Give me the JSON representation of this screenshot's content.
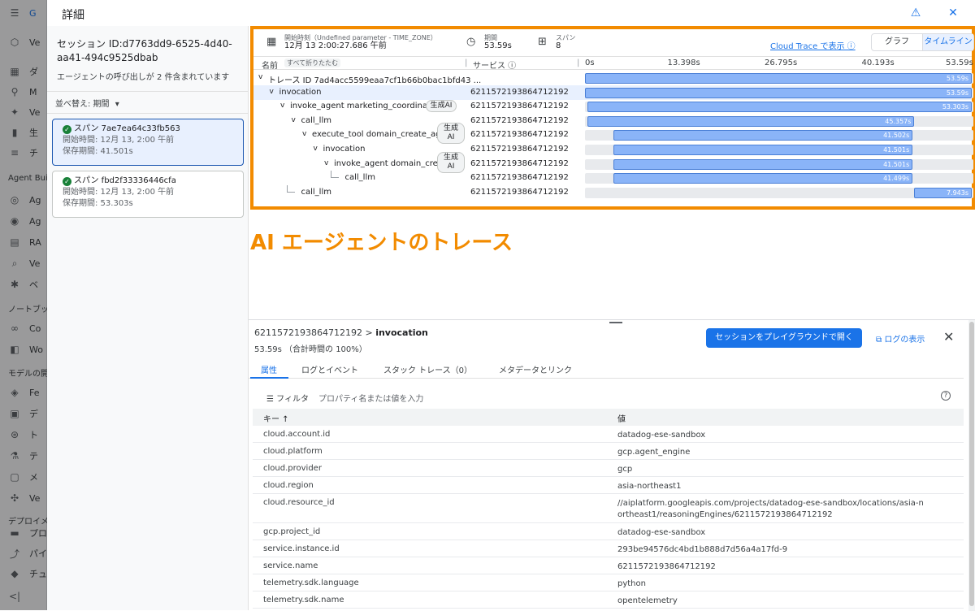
{
  "nav": {
    "items": [
      {
        "icon": "dashboard-icon",
        "glyph": "▦",
        "label": "ダ"
      },
      {
        "icon": "model-icon",
        "glyph": "⚲",
        "label": "M"
      },
      {
        "icon": "sparkle-icon",
        "glyph": "✦",
        "label": "Ve"
      },
      {
        "icon": "chart-icon",
        "glyph": "▮",
        "label": "生"
      },
      {
        "icon": "text-icon",
        "glyph": "≡",
        "label": "チ"
      }
    ],
    "section1": "Agent Bui",
    "items2": [
      {
        "icon": "agent-icon",
        "glyph": "◎",
        "label": "Ag"
      },
      {
        "icon": "engine-icon",
        "glyph": "◉",
        "label": "Ag"
      },
      {
        "icon": "rag-icon",
        "glyph": "▤",
        "label": "RA"
      },
      {
        "icon": "search-icon",
        "glyph": "⌕",
        "label": "Ve"
      },
      {
        "icon": "vector-icon",
        "glyph": "✱",
        "label": "ベ"
      }
    ],
    "section2": "ノートブッ",
    "items3": [
      {
        "icon": "colab-icon",
        "glyph": "∞",
        "label": "Co"
      },
      {
        "icon": "workbench-icon",
        "glyph": "◧",
        "label": "Wo"
      }
    ],
    "section3": "モデルの開",
    "items4": [
      {
        "icon": "feature-icon",
        "glyph": "◈",
        "label": "Fe"
      },
      {
        "icon": "dataset-icon",
        "glyph": "▣",
        "label": "デ"
      },
      {
        "icon": "training-icon",
        "glyph": "⊛",
        "label": "ト"
      },
      {
        "icon": "experiment-icon",
        "glyph": "⚗",
        "label": "テ"
      },
      {
        "icon": "metadata-icon",
        "glyph": "▢",
        "label": "メ"
      },
      {
        "icon": "vizier-icon",
        "glyph": "✣",
        "label": "Ve"
      }
    ],
    "section4": "デプロイメ",
    "items5": [
      {
        "icon": "prompt-icon",
        "glyph": "▬",
        "label": "プロ"
      },
      {
        "icon": "pipeline-icon",
        "glyph": "⤴",
        "label": "パイ"
      },
      {
        "icon": "tuning-icon",
        "glyph": "◆",
        "label": "チュ"
      }
    ],
    "collapse": "<|",
    "brand_fragment": "G",
    "brand_fragment2": "Ve"
  },
  "dialog": {
    "title": "詳細",
    "feedback_glyph": "⚠",
    "close_glyph": "✕"
  },
  "left": {
    "session_id": "セッション ID:d7763dd9-6525-4d40-aa41-494c9525dbab",
    "subtitle": "エージェントの呼び出しが 2 件含まれています",
    "sort_label": "並べ替え: 期間",
    "cards": [
      {
        "title": "スパン 7ae7ea64c33fb563",
        "start": "開始時間: 12月 13, 2:00 午前",
        "duration": "保存期間: 41.501s"
      },
      {
        "title": "スパン fbd2f33336446cfa",
        "start": "開始時間: 12月 13, 2:00 午前",
        "duration": "保存期間: 53.303s"
      }
    ]
  },
  "trace": {
    "start_label": "開始時刻（Undefined parameter - TIME_ZONE）",
    "start_value": "12月 13 2:00:27.686 午前",
    "duration_label": "期間",
    "duration_value": "53.59s",
    "span_label": "スパン",
    "span_value": "8",
    "cloud_trace_link": "Cloud Trace で表示 ⓘ",
    "view_graph": "グラフ",
    "view_timeline": "タイムライン",
    "col_name": "名前",
    "collapse_all": "すべて折りたたむ",
    "col_service": "サービス ⓘ",
    "axis_ticks": [
      "0s",
      "13.398s",
      "26.795s",
      "40.193s",
      "53.59s"
    ],
    "total_seconds": 53.59,
    "rows": [
      {
        "indent": 0,
        "toggle": "v",
        "name": "トレース ID 7ad4acc5599eaa7cf1b66b0bac1bfd43 ...",
        "service": "",
        "start": 0,
        "dur": 53.59,
        "label": "53.59s",
        "selected": false,
        "chip": ""
      },
      {
        "indent": 1,
        "toggle": "v",
        "name": "invocation",
        "service": "6211572193864712192",
        "start": 0,
        "dur": 53.59,
        "label": "53.59s",
        "selected": true,
        "chip": ""
      },
      {
        "indent": 2,
        "toggle": "v",
        "name": "invoke_agent marketing_coordinator",
        "service": "6211572193864712192",
        "start": 0.29,
        "dur": 53.303,
        "label": "53.303s",
        "selected": false,
        "chip": "生成AI"
      },
      {
        "indent": 3,
        "toggle": "v",
        "name": "call_llm",
        "service": "6211572193864712192",
        "start": 0.29,
        "dur": 45.357,
        "label": "45.357s",
        "selected": false,
        "chip": ""
      },
      {
        "indent": 4,
        "toggle": "v",
        "name": "execute_tool domain_create_ag...",
        "service": "6211572193864712192",
        "start": 3.9,
        "dur": 41.502,
        "label": "41.502s",
        "selected": false,
        "chip": "生成\nAI"
      },
      {
        "indent": 5,
        "toggle": "v",
        "name": "invocation",
        "service": "6211572193864712192",
        "start": 3.9,
        "dur": 41.501,
        "label": "41.501s",
        "selected": false,
        "chip": ""
      },
      {
        "indent": 6,
        "toggle": "v",
        "name": "invoke_agent domain_crea...",
        "service": "6211572193864712192",
        "start": 3.9,
        "dur": 41.501,
        "label": "41.501s",
        "selected": false,
        "chip": "生成\nAI"
      },
      {
        "indent": 7,
        "toggle": "",
        "name": "call_llm",
        "service": "6211572193864712192",
        "start": 3.9,
        "dur": 41.499,
        "label": "41.499s",
        "selected": false,
        "chip": ""
      },
      {
        "indent": 3,
        "toggle": "",
        "name": "call_llm",
        "service": "6211572193864712192",
        "start": 45.65,
        "dur": 7.943,
        "label": "7.943s",
        "selected": false,
        "chip": ""
      }
    ]
  },
  "headline": "AI エージェントのトレース",
  "detail": {
    "path_prefix": "6211572193864712192 > ",
    "path_name": "invocation",
    "duration": "53.59s （合計時間の 100%）",
    "playground_button": "セッションをプレイグラウンドで開く",
    "log_link": "⧉ ログの表示",
    "close_glyph": "✕",
    "tabs": [
      "属性",
      "ログとイベント",
      "スタック トレース（0）",
      "メタデータとリンク"
    ],
    "filter_label": "☰ フィルタ",
    "filter_placeholder": "プロパティ名または値を入力",
    "help_glyph": "?",
    "col_key": "キー ↑",
    "col_value": "値",
    "attributes": [
      {
        "k": "cloud.account.id",
        "v": "datadog-ese-sandbox"
      },
      {
        "k": "cloud.platform",
        "v": "gcp.agent_engine"
      },
      {
        "k": "cloud.provider",
        "v": "gcp"
      },
      {
        "k": "cloud.region",
        "v": "asia-northeast1"
      },
      {
        "k": "cloud.resource_id",
        "v": "//aiplatform.googleapis.com/projects/datadog-ese-sandbox/locations/asia-northeast1/reasoningEngines/6211572193864712192"
      },
      {
        "k": "gcp.project_id",
        "v": "datadog-ese-sandbox"
      },
      {
        "k": "service.instance.id",
        "v": "293be94576dc4bd1b888d7d56a4a17fd-9"
      },
      {
        "k": "service.name",
        "v": "6211572193864712192"
      },
      {
        "k": "telemetry.sdk.language",
        "v": "python"
      },
      {
        "k": "telemetry.sdk.name",
        "v": "opentelemetry"
      }
    ]
  },
  "colors": {
    "accent": "#1a73e8",
    "highlight": "#f28b00",
    "bar": "#8ab4f8"
  }
}
